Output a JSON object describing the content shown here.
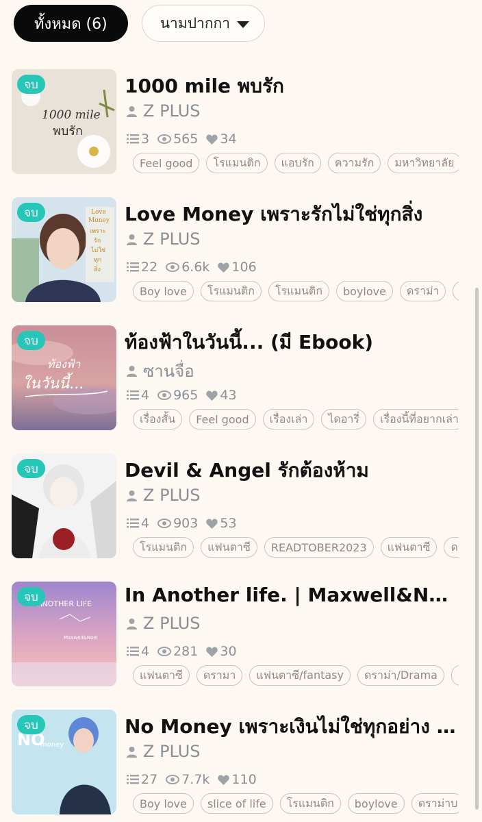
{
  "filters": {
    "all_label": "ทั้งหมด (6)",
    "pen_name_label": "นามปากกา"
  },
  "badge_label": "จบ",
  "items": [
    {
      "title": "1000 mile พบรัก",
      "author": "Z PLUS",
      "episodes": "3",
      "views": "565",
      "likes": "34",
      "tags": [
        "Feel good",
        "โรแมนติก",
        "แอบรัก",
        "ความรัก",
        "มหาวิทยาลัย"
      ],
      "cover_text": [
        "1000 mile",
        "พบรัก"
      ],
      "cover_colors": [
        "#efeae2",
        "#d9d3c8"
      ]
    },
    {
      "title": "Love Money เพราะรักไม่ใช่ทุกสิ่ง",
      "author": "Z PLUS",
      "episodes": "22",
      "views": "6.6k",
      "likes": "106",
      "tags": [
        "Boy love",
        "โรแมนติก",
        "โรแมนติก",
        "boylove",
        "ดราม่า",
        "ร"
      ],
      "cover_text": [
        "Love",
        "Money",
        "เพราะ",
        "รัก",
        "ไม่ใช่",
        "ทุก",
        "สิ่ง"
      ],
      "cover_colors": [
        "#cfe0ea",
        "#3b3f5c"
      ]
    },
    {
      "title": "ท้องฟ้าในวันนี้... (มี Ebook)",
      "author": "ซานจื่อ",
      "episodes": "4",
      "views": "965",
      "likes": "43",
      "tags": [
        "เรื่องสั้น",
        "Feel good",
        "เรื่องเล่า",
        "ไดอารี่",
        "เรื่องนี้ที่อยากเล่า"
      ],
      "cover_text": [
        "ท้องฟ้า",
        "ในวันนี้..."
      ],
      "cover_colors": [
        "#d7a3a8",
        "#6f6a8f"
      ]
    },
    {
      "title": "Devil & Angel รักต้องห้าม",
      "author": "Z PLUS",
      "episodes": "4",
      "views": "903",
      "likes": "53",
      "tags": [
        "โรแมนติก",
        "แฟนตาซี",
        "READTOBER2023",
        "แฟนตาซี",
        "ดร"
      ],
      "cover_text": [],
      "cover_colors": [
        "#f2f2f2",
        "#1c1c1c"
      ]
    },
    {
      "title": "In Another life. | Maxwell&Noel",
      "author": "Z PLUS",
      "episodes": "4",
      "views": "281",
      "likes": "30",
      "tags": [
        "แฟนตาซี",
        "ดรามา",
        "แฟนตาซี/fantasy",
        "ดราม่า/Drama",
        "r"
      ],
      "cover_text": [
        "IN ANOTHER LIFE",
        "Maxwell&Noel"
      ],
      "cover_colors": [
        "#a58bd0",
        "#f0b7b4"
      ]
    },
    {
      "title": "No Money เพราะเงินไม่ใช่ทุกอย่าง (มี...",
      "author": "Z PLUS",
      "episodes": "27",
      "views": "7.7k",
      "likes": "110",
      "tags": [
        "Boy love",
        "slice of life",
        "โรแมนติก",
        "boylove",
        "ดราม่าบ"
      ],
      "cover_text": [
        "NO",
        "money"
      ],
      "cover_colors": [
        "#bfe3ee",
        "#2a3a5c"
      ]
    }
  ]
}
